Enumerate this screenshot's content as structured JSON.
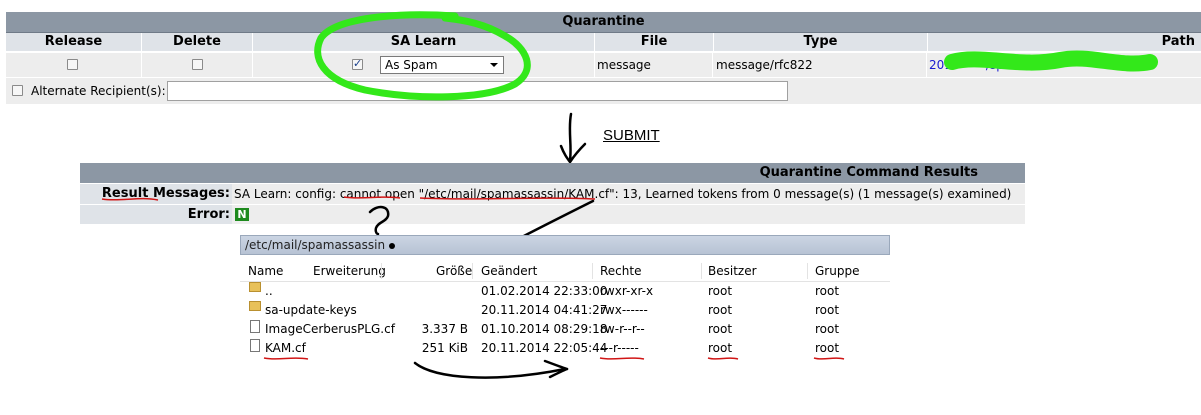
{
  "quarantine": {
    "title": "Quarantine",
    "columns": [
      "Release",
      "Delete",
      "SA Learn",
      "File",
      "Type",
      "Path"
    ],
    "row": {
      "sa_learn_checked": true,
      "sa_learn_option": "As Spam",
      "file": "message",
      "type": "message/rfc822",
      "path_start": "201",
      "path_mid": "/spar"
    },
    "alternate_label": "Alternate Recipient(s):",
    "alternate_value": ""
  },
  "annotation": {
    "submit_label": "SUBMIT"
  },
  "results": {
    "title": "Quarantine Command Results",
    "messages_label": "Result Messages:",
    "messages_value": "SA Learn: config: cannot open \"/etc/mail/spamassassin/KAM.cf\": 13, Learned tokens from 0 message(s) (1 message(s) examined)",
    "error_label": "Error:",
    "error_value": "N"
  },
  "file_browser": {
    "path": "/etc/mail/spamassassin",
    "columns": [
      "Name",
      "Erweiterung",
      "Größe",
      "Geändert",
      "Rechte",
      "Besitzer",
      "Gruppe"
    ],
    "rows": [
      {
        "name": "..",
        "size": "",
        "modified": "01.02.2014 22:33:00",
        "rights": "rwxr-xr-x",
        "owner": "root",
        "group": "root"
      },
      {
        "name": "sa-update-keys",
        "size": "",
        "modified": "20.11.2014 04:41:27",
        "rights": "rwx------",
        "owner": "root",
        "group": "root"
      },
      {
        "name": "ImageCerberusPLG.cf",
        "size": "3.337 B",
        "modified": "01.10.2014 08:29:18",
        "rights": "rw-r--r--",
        "owner": "root",
        "group": "root"
      },
      {
        "name": "KAM.cf",
        "size": "251 KiB",
        "modified": "20.11.2014 22:05:44",
        "rights": "---r-----",
        "owner": "root",
        "group": "root"
      }
    ]
  },
  "colors": {
    "header_bar": "#8c97a4",
    "highlight_circle": "#33e81a",
    "underline": "#d11515",
    "error_badge": "#1e8a1e",
    "link": "#1a1ad0"
  }
}
